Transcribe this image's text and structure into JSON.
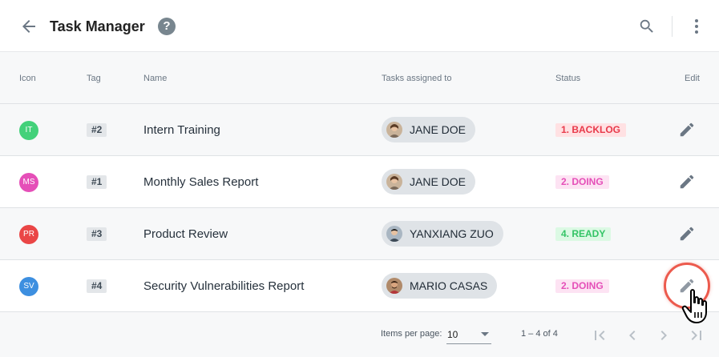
{
  "toolbar": {
    "title": "Task Manager",
    "help_label": "?",
    "back_icon": "arrow-left-icon",
    "search_icon": "search-icon",
    "more_icon": "more-vertical-icon"
  },
  "table": {
    "columns": {
      "icon": "Icon",
      "tag": "Tag",
      "name": "Name",
      "assigned": "Tasks assigned to",
      "status": "Status",
      "edit": "Edit"
    },
    "rows": [
      {
        "initials": "IT",
        "avatar_color": "#43d17a",
        "tag": "#2",
        "name": "Intern Training",
        "assignee": "JANE DOE",
        "status": "1. BACKLOG",
        "status_bg": "#ffe1e3",
        "status_color": "#e8394a"
      },
      {
        "initials": "MS",
        "avatar_color": "#e54fb8",
        "tag": "#1",
        "name": "Monthly Sales Report",
        "assignee": "JANE DOE",
        "status": "2. DOING",
        "status_bg": "#fde3f3",
        "status_color": "#e54fb8"
      },
      {
        "initials": "PR",
        "avatar_color": "#ea4646",
        "tag": "#3",
        "name": "Product Review",
        "assignee": "YANXIANG ZUO",
        "status": "4. READY",
        "status_bg": "#dcf9e4",
        "status_color": "#34c466"
      },
      {
        "initials": "SV",
        "avatar_color": "#3d8fe0",
        "tag": "#4",
        "name": "Security Vulnerabilities Report",
        "assignee": "MARIO CASAS",
        "status": "2. DOING",
        "status_bg": "#fde3f3",
        "status_color": "#e54fb8"
      }
    ]
  },
  "pagination": {
    "items_per_page_label": "Items per page:",
    "items_per_page_value": "10",
    "range_label": "1 – 4 of 4"
  },
  "colors": {
    "highlight_ring": "#ec5a4d",
    "icon_gray": "#6b7784"
  }
}
